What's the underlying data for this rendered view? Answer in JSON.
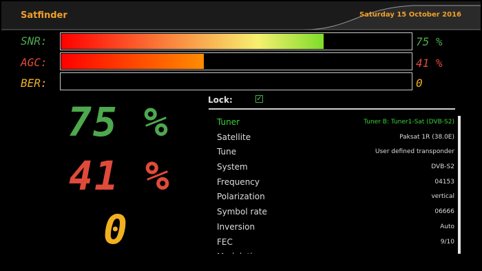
{
  "header": {
    "title": "Satfinder",
    "date": "Saturday 15 October 2016"
  },
  "meters": {
    "snr": {
      "label": "SNR:",
      "value": "75 %",
      "level": 0.75,
      "color_start": "#ff0000",
      "color_end": "#7fdc2a"
    },
    "agc": {
      "label": "AGC:",
      "value": "41 %",
      "level": 0.41,
      "color_start": "#ff0000",
      "color_end": "#ff8c00"
    },
    "ber": {
      "label": "BER:",
      "value": "0",
      "level": 0.0
    }
  },
  "readouts": {
    "snr": "75 %",
    "agc": "41 %",
    "ber": "0"
  },
  "lock": {
    "label": "Lock:",
    "checked": true,
    "check_glyph": "✓"
  },
  "info": [
    {
      "key": "Tuner",
      "value": "Tuner B: Tuner1-Sat (DVB-S2)"
    },
    {
      "key": "Satellite",
      "value": "Paksat 1R (38.0E)"
    },
    {
      "key": "Tune",
      "value": "User defined transponder"
    },
    {
      "key": "System",
      "value": "DVB-S2"
    },
    {
      "key": "Frequency",
      "value": "04153"
    },
    {
      "key": "Polarization",
      "value": "vertical"
    },
    {
      "key": "Symbol rate",
      "value": "06666"
    },
    {
      "key": "Inversion",
      "value": "Auto"
    },
    {
      "key": "FEC",
      "value": "9/10"
    },
    {
      "key": "Modulation",
      "value": ""
    }
  ],
  "colors": {
    "accent": "#f0a028",
    "snr": "#4ea84e",
    "agc": "#e04a3a",
    "ber": "#f0b020",
    "lock": "#38d038"
  }
}
